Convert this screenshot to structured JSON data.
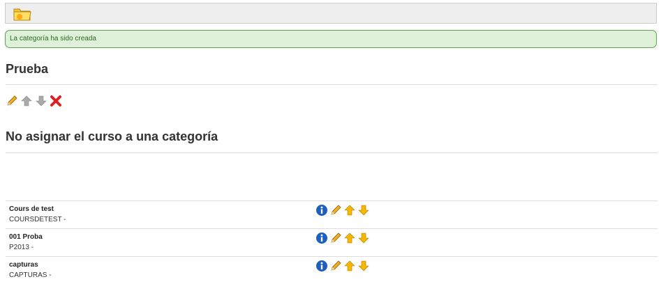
{
  "toolbar": {
    "icon": "folder-icon"
  },
  "alert": {
    "text": "La categoría ha sido creada"
  },
  "category": {
    "title": "Prueba",
    "actions": [
      "edit-icon",
      "arrow-up-icon",
      "arrow-down-icon",
      "delete-icon"
    ]
  },
  "unassigned": {
    "title": "No asignar el curso a una categoría"
  },
  "courses": [
    {
      "title": "Cours de test",
      "code": "COURSDETEST -"
    },
    {
      "title": "001 Proba",
      "code": "P2013 -"
    },
    {
      "title": "capturas",
      "code": "CAPTURAS -"
    }
  ],
  "colors": {
    "success_bg": "#dff0d8",
    "success_border": "#5aa351",
    "success_text": "#2a6b22",
    "arrow_active": "#f5b800",
    "arrow_disabled": "#aaaaaa",
    "delete": "#e02020",
    "info": "#1f5fbf"
  }
}
